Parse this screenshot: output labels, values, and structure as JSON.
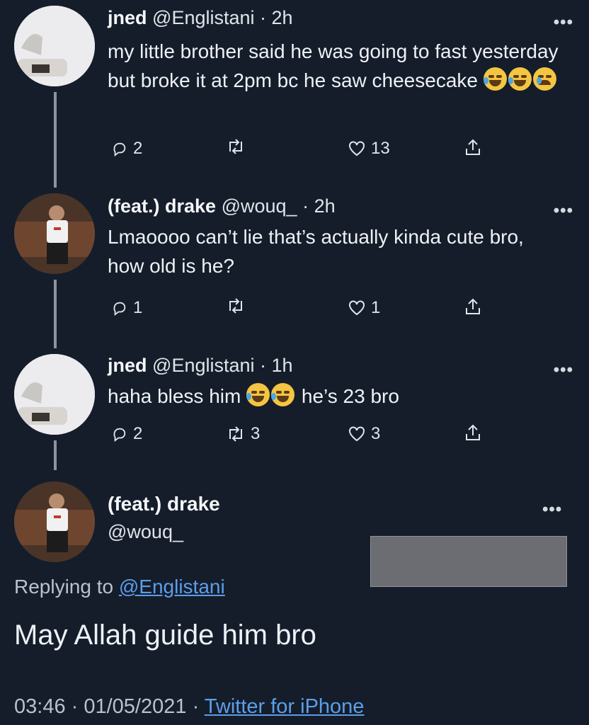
{
  "tweets": [
    {
      "name": "jned",
      "handle": "@Englistani",
      "time": "· 2h",
      "text": "my little brother said he was going to fast yesterday but broke it at 2pm bc he saw cheesecake",
      "emojis": [
        "face-with-tears-of-joy",
        "face-with-tears-of-joy",
        "loudly-crying-face"
      ],
      "replies": "2",
      "retweets": "",
      "likes": "13"
    },
    {
      "name": "(feat.) drake",
      "handle": "@wouq_",
      "time": "· 2h",
      "text": "Lmaoooo can’t lie that’s actually kinda cute bro, how old is he?",
      "replies": "1",
      "retweets": "",
      "likes": "1"
    },
    {
      "name": "jned",
      "handle": "@Englistani",
      "time": "· 1h",
      "text_before": "haha bless him",
      "emojis": [
        "face-with-tears-of-joy",
        "face-with-tears-of-joy"
      ],
      "text_after": "he’s 23 bro",
      "replies": "2",
      "retweets": "3",
      "likes": "3"
    }
  ],
  "main_tweet": {
    "name": "(feat.) drake",
    "handle": "@wouq_",
    "replying_prefix": "Replying to",
    "replying_to": "@Englistani",
    "text": "May Allah guide him bro",
    "time": "03:46",
    "date": "01/05/2021",
    "source": "Twitter for iPhone"
  },
  "more_icon": "more-dots-icon",
  "colors": {
    "background": "#151d2b",
    "link": "#5c9ee8",
    "text": "#eef1f5"
  }
}
